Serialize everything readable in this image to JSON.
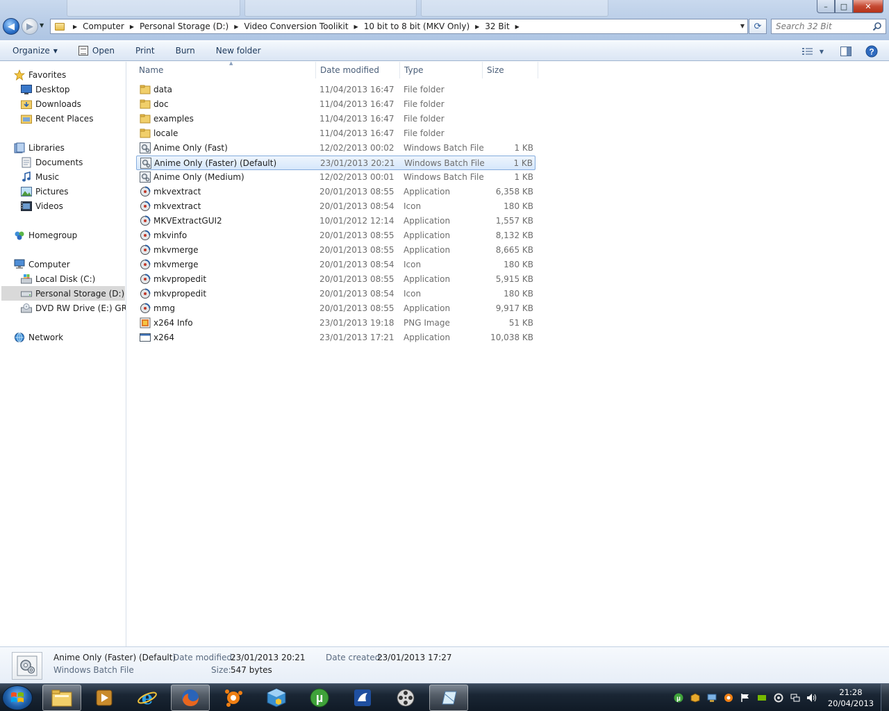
{
  "window": {
    "minimize": "–",
    "maximize": "□",
    "close": "✕"
  },
  "address": {
    "crumbs": [
      "Computer",
      "Personal Storage (D:)",
      "Video Conversion Toolikit",
      "10 bit to 8 bit (MKV Only)",
      "32 Bit"
    ]
  },
  "search": {
    "placeholder": "Search 32 Bit"
  },
  "toolbar": {
    "organize": "Organize",
    "open": "Open",
    "print": "Print",
    "burn": "Burn",
    "new_folder": "New folder"
  },
  "nav": {
    "favorites": "Favorites",
    "desktop": "Desktop",
    "downloads": "Downloads",
    "recent_places": "Recent Places",
    "libraries": "Libraries",
    "documents": "Documents",
    "music": "Music",
    "pictures": "Pictures",
    "videos": "Videos",
    "homegroup": "Homegroup",
    "computer": "Computer",
    "local_disk": "Local Disk (C:)",
    "personal_storage": "Personal Storage (D:)",
    "dvd_drive": "DVD RW Drive (E:) GRMC",
    "network": "Network"
  },
  "columns": {
    "name": "Name",
    "date": "Date modified",
    "type": "Type",
    "size": "Size"
  },
  "files": [
    {
      "name": "data",
      "date": "11/04/2013 16:47",
      "type": "File folder",
      "size": "",
      "icon": "folder-icon"
    },
    {
      "name": "doc",
      "date": "11/04/2013 16:47",
      "type": "File folder",
      "size": "",
      "icon": "folder-icon"
    },
    {
      "name": "examples",
      "date": "11/04/2013 16:47",
      "type": "File folder",
      "size": "",
      "icon": "folder-icon"
    },
    {
      "name": "locale",
      "date": "11/04/2013 16:47",
      "type": "File folder",
      "size": "",
      "icon": "folder-icon"
    },
    {
      "name": "Anime Only (Fast)",
      "date": "12/02/2013 00:02",
      "type": "Windows Batch File",
      "size": "1 KB",
      "icon": "batch-file-icon"
    },
    {
      "name": "Anime Only (Faster) (Default)",
      "date": "23/01/2013 20:21",
      "type": "Windows Batch File",
      "size": "1 KB",
      "icon": "batch-file-icon",
      "selected": true
    },
    {
      "name": "Anime Only (Medium)",
      "date": "12/02/2013 00:01",
      "type": "Windows Batch File",
      "size": "1 KB",
      "icon": "batch-file-icon"
    },
    {
      "name": "mkvextract",
      "date": "20/01/2013 08:55",
      "type": "Application",
      "size": "6,358 KB",
      "icon": "mkv-app-icon"
    },
    {
      "name": "mkvextract",
      "date": "20/01/2013 08:54",
      "type": "Icon",
      "size": "180 KB",
      "icon": "mkv-app-icon"
    },
    {
      "name": "MKVExtractGUI2",
      "date": "10/01/2012 12:14",
      "type": "Application",
      "size": "1,557 KB",
      "icon": "mkv-app-icon"
    },
    {
      "name": "mkvinfo",
      "date": "20/01/2013 08:55",
      "type": "Application",
      "size": "8,132 KB",
      "icon": "mkv-app-icon"
    },
    {
      "name": "mkvmerge",
      "date": "20/01/2013 08:55",
      "type": "Application",
      "size": "8,665 KB",
      "icon": "mkv-app-icon"
    },
    {
      "name": "mkvmerge",
      "date": "20/01/2013 08:54",
      "type": "Icon",
      "size": "180 KB",
      "icon": "mkv-app-icon"
    },
    {
      "name": "mkvpropedit",
      "date": "20/01/2013 08:55",
      "type": "Application",
      "size": "5,915 KB",
      "icon": "mkv-app-icon"
    },
    {
      "name": "mkvpropedit",
      "date": "20/01/2013 08:54",
      "type": "Icon",
      "size": "180 KB",
      "icon": "mkv-app-icon"
    },
    {
      "name": "mmg",
      "date": "20/01/2013 08:55",
      "type": "Application",
      "size": "9,917 KB",
      "icon": "mkv-app-icon"
    },
    {
      "name": "x264 Info",
      "date": "23/01/2013 19:18",
      "type": "PNG Image",
      "size": "51 KB",
      "icon": "png-image-icon"
    },
    {
      "name": "x264",
      "date": "23/01/2013 17:21",
      "type": "Application",
      "size": "10,038 KB",
      "icon": "application-icon"
    }
  ],
  "details": {
    "name": "Anime Only (Faster) (Default)",
    "type": "Windows Batch File",
    "modified_label": "Date modified:",
    "modified_value": "23/01/2013 20:21",
    "created_label": "Date created:",
    "created_value": "23/01/2013 17:27",
    "size_label": "Size:",
    "size_value": "547 bytes"
  },
  "taskbar": {
    "time": "21:28",
    "date": "20/04/2013"
  }
}
